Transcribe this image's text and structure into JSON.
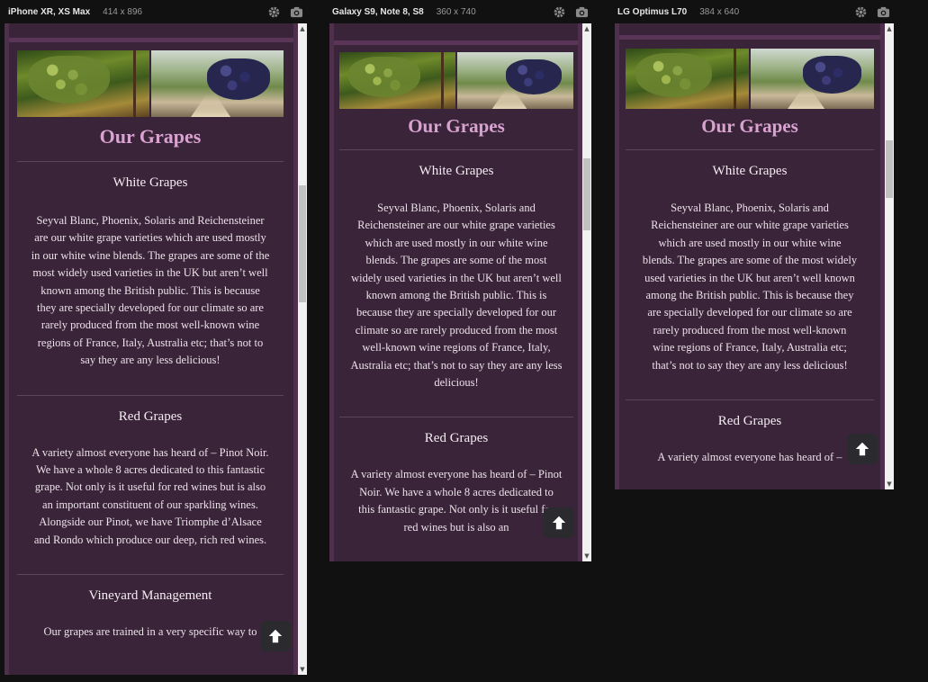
{
  "devices": [
    {
      "name": "iPhone XR, XS Max",
      "size": "414 x 896",
      "page": {
        "title": "Our Grapes",
        "sections": [
          {
            "heading": "White Grapes",
            "text": "Seyval Blanc, Phoenix, Solaris and Reichensteiner are our white grape varieties which are used mostly in our white wine blends. The grapes are some of the most widely used varieties in the UK but aren’t well known among the British public. This is because they are specially developed for our climate so are rarely produced from the most well-known wine regions of France, Italy, Australia etc; that’s not to say they are any less delicious!"
          },
          {
            "heading": "Red Grapes",
            "text": "A variety almost everyone has heard of – Pinot Noir. We have a whole 8 acres dedicated to this fantastic grape. Not only is it useful for red wines but is also an important constituent of our sparkling wines. Alongside our Pinot, we have Triomphe d’Alsace and Rondo which produce our deep, rich red wines."
          },
          {
            "heading": "Vineyard Management",
            "text": "Our grapes are trained in a very specific way to"
          }
        ]
      },
      "icons": [
        "settings-icon",
        "camera-icon",
        "arrow-up-icon"
      ]
    },
    {
      "name": "Galaxy S9, Note 8, S8",
      "size": "360 x 740",
      "page": {
        "title": "Our Grapes",
        "sections": [
          {
            "heading": "White Grapes",
            "text": "Seyval Blanc, Phoenix, Solaris and Reichensteiner are our white grape varieties which are used mostly in our white wine blends. The grapes are some of the most widely used varieties in the UK but aren’t well known among the British public. This is because they are specially developed for our climate so are rarely produced from the most well-known wine regions of France, Italy, Australia etc; that’s not to say they are any less delicious!"
          },
          {
            "heading": "Red Grapes",
            "text": "A variety almost everyone has heard of – Pinot Noir. We have a whole 8 acres dedicated to this fantastic grape. Not only is it useful for red wines but is also an"
          }
        ]
      },
      "icons": [
        "settings-icon",
        "camera-icon",
        "arrow-up-icon"
      ]
    },
    {
      "name": "LG Optimus L70",
      "size": "384 x 640",
      "page": {
        "title": "Our Grapes",
        "sections": [
          {
            "heading": "White Grapes",
            "text": "Seyval Blanc, Phoenix, Solaris and Reichensteiner are our white grape varieties which are used mostly in our white wine blends. The grapes are some of the most widely used varieties in the UK but aren’t well known among the British public. This is because they are specially developed for our climate so are rarely produced from the most well-known wine regions of France, Italy, Australia etc; that’s not to say they are any less delicious!"
          },
          {
            "heading": "Red Grapes",
            "text": "A variety almost everyone has heard of –"
          }
        ]
      },
      "icons": [
        "settings-icon",
        "camera-icon",
        "arrow-up-icon"
      ]
    }
  ],
  "colors": {
    "background": "#111111",
    "page": "#3a2439",
    "page_border": "#4e2f4c",
    "title": "#d9a2d0",
    "text": "#ece2ea"
  }
}
